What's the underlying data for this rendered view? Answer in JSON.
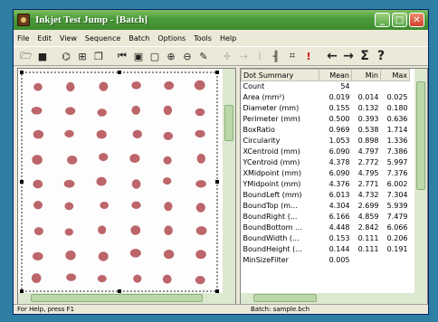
{
  "window": {
    "title": "Inkjet Test Jump - [Batch]",
    "controls": [
      "minimize",
      "maximize",
      "close"
    ]
  },
  "menu": [
    "File",
    "Edit",
    "View",
    "Sequence",
    "Batch",
    "Options",
    "Tools",
    "Help"
  ],
  "toolbar": [
    {
      "icon": "open-folder-icon"
    },
    {
      "icon": "save-icon"
    },
    {
      "icon": "sep"
    },
    {
      "icon": "capture-icon"
    },
    {
      "icon": "measure-icon"
    },
    {
      "icon": "copy-icon"
    },
    {
      "icon": "sep"
    },
    {
      "icon": "first-frame-icon"
    },
    {
      "icon": "grid-icon"
    },
    {
      "icon": "frame-icon"
    },
    {
      "icon": "zoom-in-icon"
    },
    {
      "icon": "zoom-out-icon"
    },
    {
      "icon": "run-batch-icon"
    },
    {
      "icon": "sep"
    },
    {
      "icon": "cross-icon",
      "dim": true
    },
    {
      "icon": "move-icon",
      "dim": true
    },
    {
      "icon": "link-icon",
      "dim": true
    },
    {
      "icon": "pipe-icon"
    },
    {
      "icon": "crop-icon"
    },
    {
      "icon": "alert-icon"
    },
    {
      "icon": "sep"
    },
    {
      "icon": "left-arrow-icon"
    },
    {
      "icon": "right-arrow-icon"
    },
    {
      "icon": "sum-icon"
    },
    {
      "icon": "help-icon"
    }
  ],
  "table": {
    "headers": [
      "Dot Summary",
      "Mean",
      "Min",
      "Max"
    ],
    "rows": [
      [
        "Count",
        "54",
        "",
        ""
      ],
      [
        "Area (mm²)",
        "0.019",
        "0.014",
        "0.025"
      ],
      [
        "Diameter (mm)",
        "0.155",
        "0.132",
        "0.180"
      ],
      [
        "Perimeter (mm)",
        "0.500",
        "0.393",
        "0.636"
      ],
      [
        "BoxRatio",
        "0.969",
        "0.538",
        "1.714"
      ],
      [
        "Circularity",
        "1.053",
        "0.898",
        "1.336"
      ],
      [
        "XCentroid (mm)",
        "6.090",
        "4.797",
        "7.386"
      ],
      [
        "YCentroid (mm)",
        "4.378",
        "2.772",
        "5.997"
      ],
      [
        "XMidpoint (mm)",
        "6.090",
        "4.795",
        "7.376"
      ],
      [
        "YMidpoint (mm)",
        "4.376",
        "2.771",
        "6.002"
      ],
      [
        "BoundLeft (mm)",
        "6.013",
        "4.732",
        "7.304"
      ],
      [
        "BoundTop (m...",
        "4.304",
        "2.699",
        "5.939"
      ],
      [
        "BoundRight (...",
        "6.166",
        "4.859",
        "7.479"
      ],
      [
        "BoundBottom ...",
        "4.448",
        "2.842",
        "6.066"
      ],
      [
        "BoundWidth (...",
        "0.153",
        "0.111",
        "0.206"
      ],
      [
        "BoundHeight (...",
        "0.144",
        "0.111",
        "0.191"
      ],
      [
        "MinSizeFilter",
        "0.005",
        "",
        ""
      ]
    ]
  },
  "status": {
    "left": "For Help, press F1",
    "right": "Batch: sample.bch"
  },
  "colors": {
    "dot": "#b5545a",
    "titlebar": "#4a9a3a",
    "background": "#2e7fa3"
  }
}
